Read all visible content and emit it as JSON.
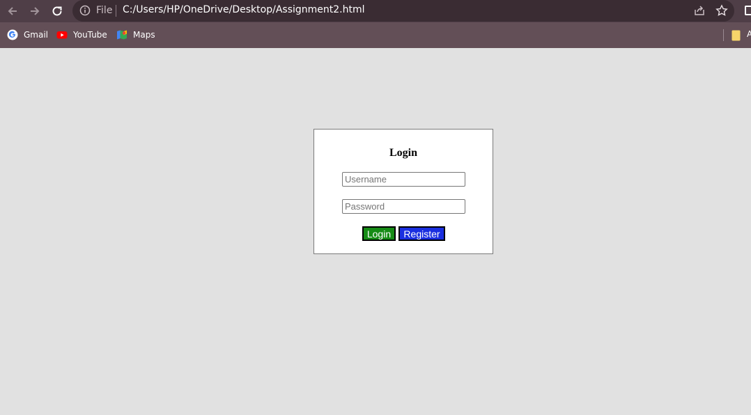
{
  "browser": {
    "address_bar": {
      "scheme_label": "File",
      "url": "C:/Users/HP/OneDrive/Desktop/Assignment2.html"
    },
    "bookmarks": [
      {
        "label": "Gmail",
        "icon": "google-icon"
      },
      {
        "label": "YouTube",
        "icon": "youtube-icon"
      },
      {
        "label": "Maps",
        "icon": "maps-icon"
      }
    ],
    "bookmarks_folder_label": "A"
  },
  "login": {
    "title": "Login",
    "username_placeholder": "Username",
    "password_placeholder": "Password",
    "login_label": "Login",
    "register_label": "Register"
  },
  "colors": {
    "toolbar": "#4f3e47",
    "bookmarks_bar": "#634f57",
    "page_background": "#e1e1e1",
    "login_button": "#168c16",
    "register_button": "#1a2fe0"
  }
}
